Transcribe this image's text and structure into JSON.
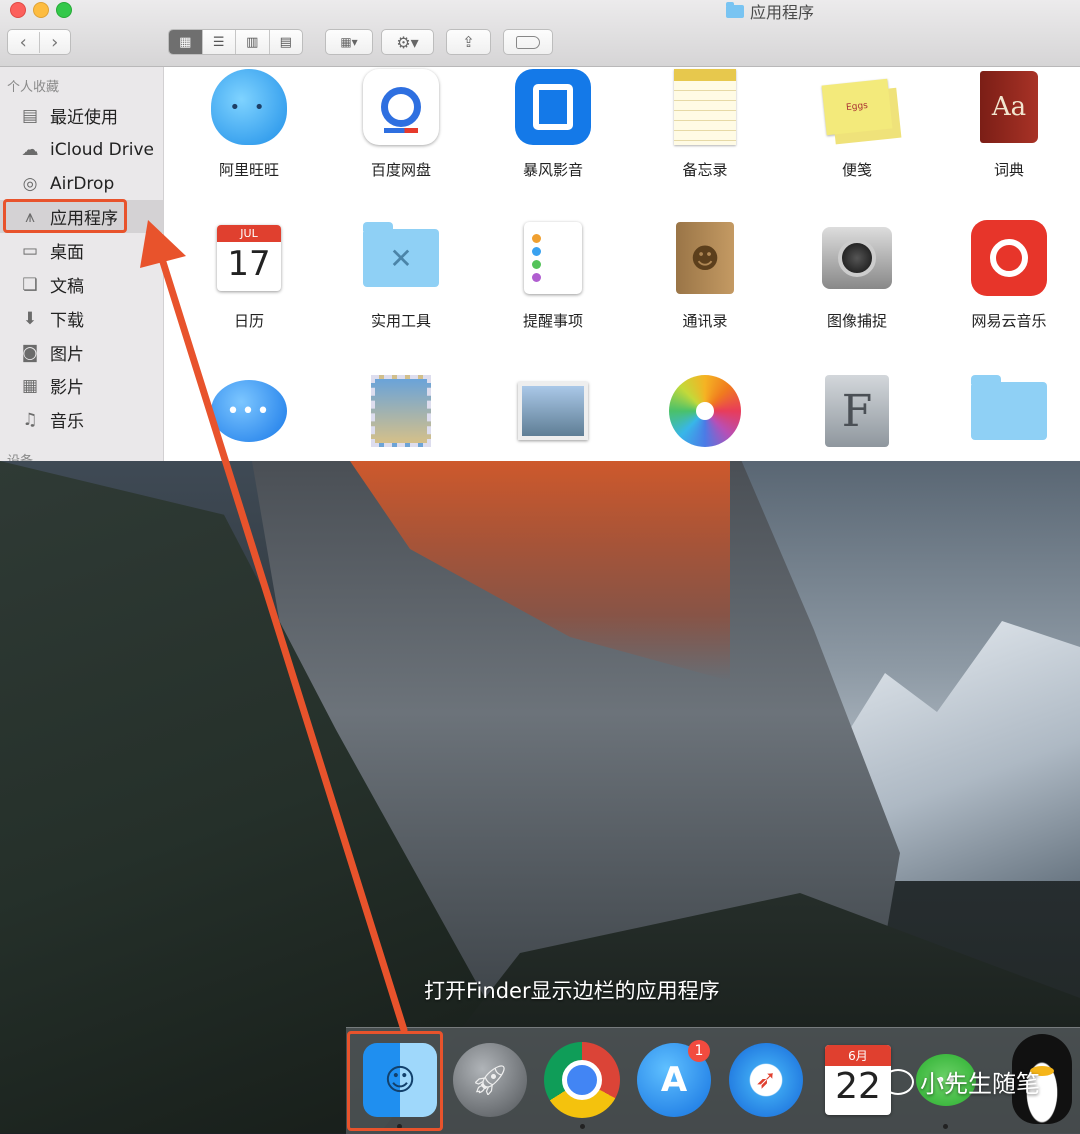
{
  "window": {
    "title": "应用程序",
    "controls": {
      "close_color": "#fc605c",
      "minimize_color": "#fdbc40",
      "zoom_color": "#34c84a"
    }
  },
  "toolbar": {
    "back_icon": "chevron-left-icon",
    "forward_icon": "chevron-right-icon",
    "view_modes": [
      "icon-view-icon",
      "list-view-icon",
      "column-view-icon",
      "gallery-view-icon"
    ],
    "active_view": 0,
    "arrange_icon": "arrange-icon",
    "action_icon": "gear-icon",
    "share_icon": "share-icon",
    "tag_icon": "tag-icon"
  },
  "sidebar": {
    "favorites_header": "个人收藏",
    "items": [
      {
        "label": "最近使用",
        "icon": "recents-icon"
      },
      {
        "label": "iCloud Drive",
        "icon": "cloud-icon"
      },
      {
        "label": "AirDrop",
        "icon": "airdrop-icon"
      },
      {
        "label": "应用程序",
        "icon": "applications-icon",
        "selected": true
      },
      {
        "label": "桌面",
        "icon": "desktop-icon"
      },
      {
        "label": "文稿",
        "icon": "documents-icon"
      },
      {
        "label": "下载",
        "icon": "download-icon"
      },
      {
        "label": "图片",
        "icon": "camera-icon"
      },
      {
        "label": "影片",
        "icon": "film-icon"
      },
      {
        "label": "音乐",
        "icon": "music-icon"
      }
    ],
    "devices_header": "设备"
  },
  "apps": [
    {
      "label": "阿里旺旺",
      "icon": "aliwangwang-icon"
    },
    {
      "label": "百度网盘",
      "icon": "baidu-netdisk-icon"
    },
    {
      "label": "暴风影音",
      "icon": "baofeng-icon"
    },
    {
      "label": "备忘录",
      "icon": "notes-icon"
    },
    {
      "label": "便笺",
      "icon": "stickies-icon",
      "icon_text": "Eggs"
    },
    {
      "label": "词典",
      "icon": "dictionary-icon",
      "icon_text": "Aa"
    },
    {
      "label": "日历",
      "icon": "calendar-icon",
      "icon_month": "JUL",
      "icon_day": "17"
    },
    {
      "label": "实用工具",
      "icon": "utilities-folder-icon"
    },
    {
      "label": "提醒事项",
      "icon": "reminders-icon"
    },
    {
      "label": "通讯录",
      "icon": "contacts-icon"
    },
    {
      "label": "图像捕捉",
      "icon": "image-capture-icon"
    },
    {
      "label": "网易云音乐",
      "icon": "netease-music-icon"
    },
    {
      "label": "",
      "icon": "messages-icon"
    },
    {
      "label": "",
      "icon": "preview-icon"
    },
    {
      "label": "",
      "icon": "photo-booth-icon"
    },
    {
      "label": "",
      "icon": "photos-icon"
    },
    {
      "label": "",
      "icon": "font-book-icon",
      "icon_text": "F"
    },
    {
      "label": "",
      "icon": "folder-icon"
    }
  ],
  "caption": "打开Finder显示边栏的应用程序",
  "dock": {
    "items": [
      {
        "icon": "finder-icon",
        "highlighted": true
      },
      {
        "icon": "launchpad-icon"
      },
      {
        "icon": "chrome-icon"
      },
      {
        "icon": "app-store-icon",
        "badge": "1"
      },
      {
        "icon": "safari-icon"
      },
      {
        "icon": "calendar-icon",
        "month": "6月",
        "day": "22"
      },
      {
        "icon": "wechat-icon"
      },
      {
        "icon": "qq-penguin-icon"
      }
    ]
  },
  "watermark": {
    "text": "小先生随笔",
    "icon": "wechat-logo-icon"
  },
  "annotation": {
    "arrow_color": "#e8532c",
    "box_color": "#e8532c"
  }
}
